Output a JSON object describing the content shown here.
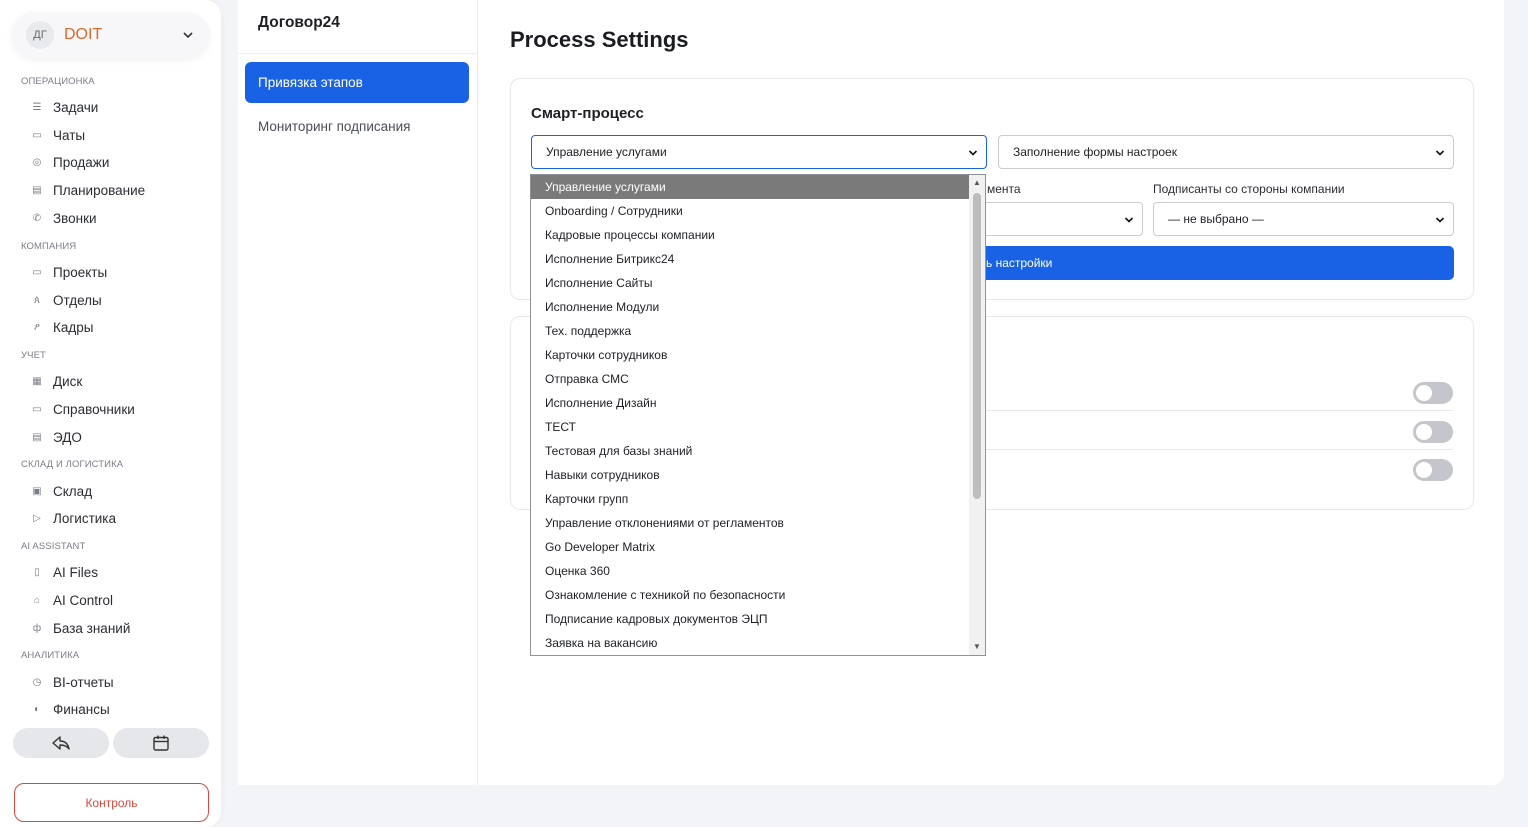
{
  "sidebar": {
    "org": {
      "avatar": "ДГ",
      "name": "DOIT"
    },
    "sections": {
      "ops": "ОПЕРАЦИОНКА",
      "company": "КОМПАНИЯ",
      "accounting": "УЧЕТ",
      "warehouse": "СКЛАД И ЛОГИСТИКА",
      "ai": "AI ASSISTANT",
      "analytics": "АНАЛИТИКА"
    },
    "items": {
      "tasks": "Задачи",
      "chats": "Чаты",
      "sales": "Продажи",
      "planning": "Планирование",
      "calls": "Звонки",
      "projects": "Проекты",
      "departments": "Отделы",
      "staff": "Кадры",
      "disk": "Диск",
      "directories": "Справочники",
      "edo": "ЭДО",
      "warehouse": "Склад",
      "logistics": "Логистика",
      "ai_files": "AI Files",
      "ai_control": "AI Control",
      "knowledge": "База знаний",
      "bi": "BI-отчеты",
      "finance": "Финансы"
    },
    "control_button": "Контроль"
  },
  "middle": {
    "title": "Договор24",
    "items": [
      "Привязка этапов",
      "Мониторинг подписания"
    ]
  },
  "main": {
    "page_title": "Process Settings",
    "card1": {
      "title": "Смарт-процесс",
      "process_select": "Управление услугами",
      "stage_select": "Заполнение формы настроек",
      "label_doc_partial": "мента",
      "label_signers": "Подписанты со стороны компании",
      "signers_select": "— не выбрано —",
      "save_partial": "ь настройки"
    }
  },
  "dropdown": {
    "options": [
      "Управление услугами",
      "Onboarding / Сотрудники",
      "Кадровые процессы компании",
      "Исполнение Битрикс24",
      "Исполнение Сайты",
      "Исполнение Модули",
      "Тех. поддержка",
      "Карточки сотрудников",
      "Отправка СМС",
      "Исполнение Дизайн",
      "ТЕСТ",
      "Тестовая для базы знаний",
      "Навыки сотрудников",
      "Карточки групп",
      "Управление отклонениями от регламентов",
      "Go Developer Matrix",
      "Оценка 360",
      "Ознакомление с техникой по безопасности",
      "Подписание кадровых документов ЭЦП",
      "Заявка на вакансию"
    ]
  },
  "colors": {
    "accent": "#1a62e5",
    "brand": "#e0682b",
    "danger": "#e0463c",
    "selected_option": "#7a7a7a"
  }
}
